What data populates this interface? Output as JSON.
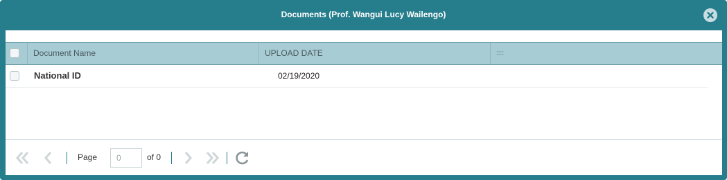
{
  "dialog": {
    "title": "Documents (Prof. Wangui Lucy Wailengo)",
    "close_icon": "close-circle-icon"
  },
  "grid": {
    "columns": [
      "Document Name",
      "UPLOAD DATE",
      "::::"
    ],
    "rows": [
      {
        "name": "National ID",
        "upload_date": "02/19/2020"
      }
    ]
  },
  "pager": {
    "page_label": "Page",
    "page_value": "0",
    "of_label": "of 0",
    "icons": [
      "first-page-icon",
      "prev-page-icon",
      "next-page-icon",
      "last-page-icon",
      "refresh-icon"
    ]
  },
  "colors": {
    "accent": "#267d8c",
    "header_bg": "#a8ccd4"
  }
}
